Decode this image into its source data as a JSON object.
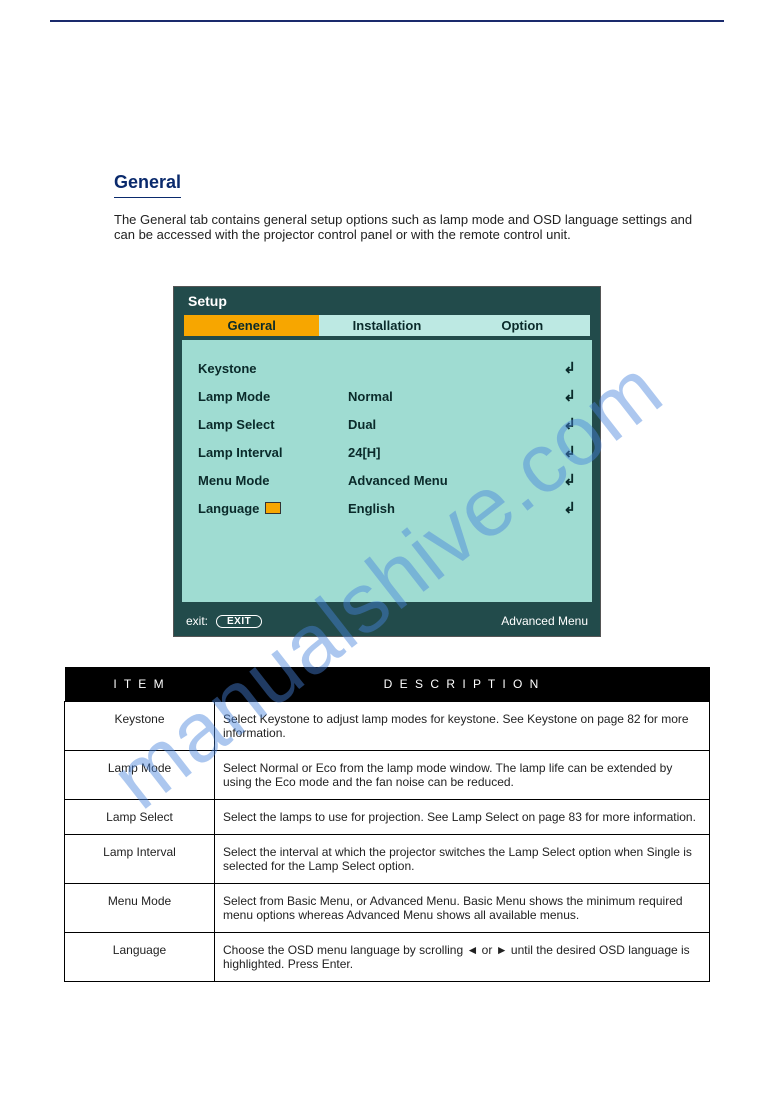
{
  "watermark": "manualshive.com",
  "section": {
    "heading": "General",
    "desc": "The General tab contains general setup options such as lamp mode and OSD language settings and can be accessed with the projector control panel or with the remote control unit."
  },
  "osd": {
    "title": "Setup",
    "tabs": [
      "General",
      "Installation",
      "Option"
    ],
    "active_tab": 0,
    "footer_exit_label": "exit:",
    "footer_exit_btn": "EXIT",
    "footer_right": "Advanced Menu",
    "rows": [
      {
        "label": "Keystone",
        "value": ""
      },
      {
        "label": "Lamp Mode",
        "value": "Normal"
      },
      {
        "label": "Lamp Select",
        "value": "Dual"
      },
      {
        "label": "Lamp Interval",
        "value": "24[H]"
      },
      {
        "label": "Menu Mode",
        "value": "Advanced Menu"
      },
      {
        "label": "Language",
        "value": "English",
        "icon": true
      }
    ]
  },
  "desc_table": {
    "head_item": "I T E M",
    "head_desc": "D E S C R I P T I O N",
    "rows": [
      {
        "item": "Keystone",
        "desc": "Select Keystone to adjust lamp modes for keystone. See Keystone on page 82 for more information."
      },
      {
        "item": "Lamp Mode",
        "desc": "Select Normal or Eco from the lamp mode window. The lamp life can be extended by using the Eco mode and the fan noise can be reduced."
      },
      {
        "item": "Lamp Select",
        "desc": "Select the lamps to use for projection. See Lamp Select on page 83 for more information."
      },
      {
        "item": "Lamp Interval",
        "desc": "Select the interval at which the projector switches the Lamp Select option when Single is selected for the Lamp Select option."
      },
      {
        "item": "Menu Mode",
        "desc": "Select from Basic Menu, or Advanced Menu. Basic Menu shows the minimum required menu options whereas Advanced Menu shows all available menus."
      },
      {
        "item": "Language",
        "desc": "Choose the OSD menu language by scrolling ◄ or ► until the desired OSD language is highlighted. Press Enter."
      }
    ]
  }
}
